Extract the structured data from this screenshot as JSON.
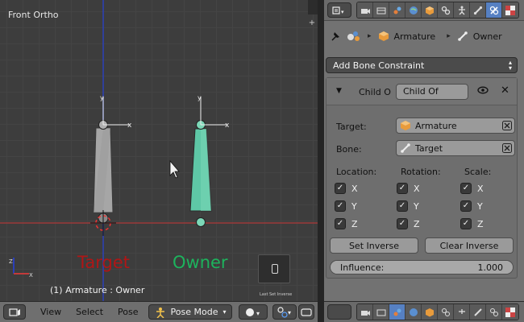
{
  "viewport": {
    "title": "Front Ortho",
    "status": "(1) Armature : Owner",
    "target_label": "Target",
    "owner_label": "Owner",
    "last_operator": "Last Set Inverse"
  },
  "header": {
    "menus": [
      "View",
      "Select",
      "Pose"
    ],
    "mode": "Pose Mode"
  },
  "properties": {
    "breadcrumb": {
      "object": "Armature",
      "bone": "Owner"
    },
    "add_constraint": "Add Bone Constraint",
    "constraint": {
      "short_name": "Child O",
      "name": "Child Of",
      "target_label": "Target:",
      "target_value": "Armature",
      "bone_label": "Bone:",
      "bone_value": "Target",
      "location_label": "Location:",
      "rotation_label": "Rotation:",
      "scale_label": "Scale:",
      "axes": [
        "X",
        "Y",
        "Z"
      ],
      "set_inverse": "Set Inverse",
      "clear_inverse": "Clear Inverse",
      "influence_label": "Influence:",
      "influence_value": "1.000",
      "influence": 1.0
    }
  },
  "colors": {
    "target_text": "#b01616",
    "owner_text": "#1db35d",
    "owner_bone": "#5ec7a6",
    "target_bone": "#a6a6a6",
    "active_tab": "#5680c2"
  }
}
